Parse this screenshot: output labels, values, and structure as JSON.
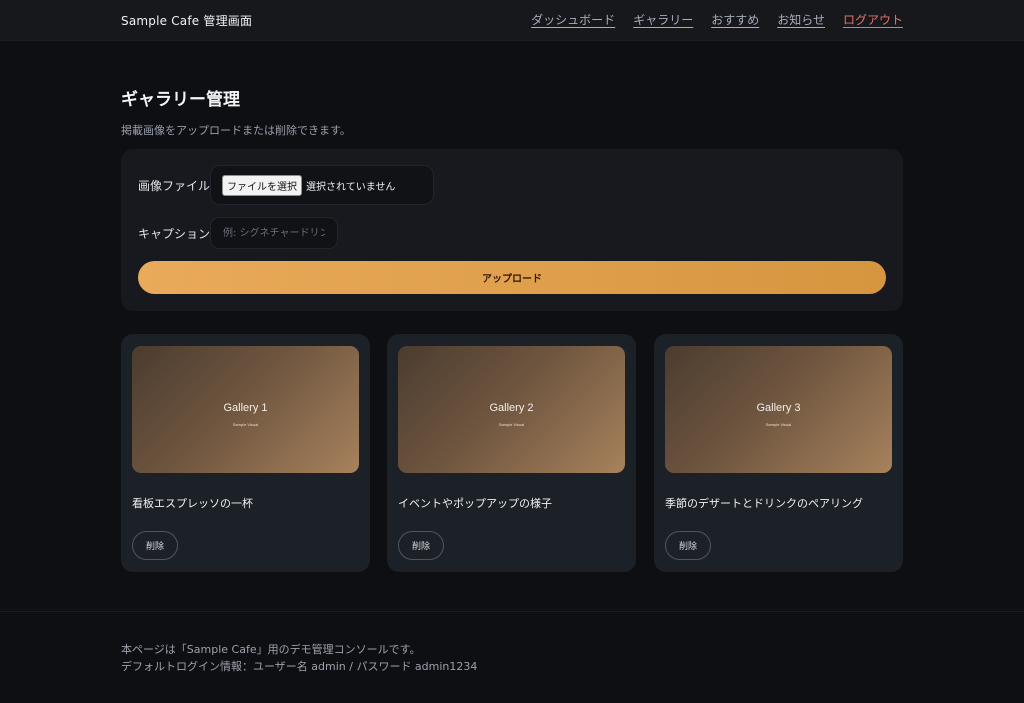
{
  "header": {
    "brand": "Sample Cafe 管理画面",
    "nav": [
      {
        "label": "ダッシュボード"
      },
      {
        "label": "ギャラリー"
      },
      {
        "label": "おすすめ"
      },
      {
        "label": "お知らせ"
      },
      {
        "label": "ログアウト"
      }
    ]
  },
  "page": {
    "title": "ギャラリー管理",
    "subtitle": "掲載画像をアップロードまたは削除できます。"
  },
  "upload": {
    "file_label": "画像ファイル",
    "file_button": "ファイルを選択",
    "file_status": "選択されていません",
    "caption_label": "キャプション",
    "caption_placeholder": "例: シグネチャードリンク",
    "caption_value": "",
    "submit_label": "アップロード"
  },
  "gallery": [
    {
      "visual_title": "Gallery 1",
      "visual_sub": "Sample Visual",
      "caption": "看板エスプレッソの一杯",
      "delete_label": "削除"
    },
    {
      "visual_title": "Gallery 2",
      "visual_sub": "Sample Visual",
      "caption": "イベントやポップアップの様子",
      "delete_label": "削除"
    },
    {
      "visual_title": "Gallery 3",
      "visual_sub": "Sample Visual",
      "caption": "季節のデザートとドリンクのペアリング",
      "delete_label": "削除"
    }
  ],
  "footer": {
    "line1": "本ページは「Sample Cafe」用のデモ管理コンソールです。",
    "line2": "デフォルトログイン情報：ユーザー名 admin / パスワード admin1234"
  },
  "colors": {
    "accent_start": "#e9aa5a",
    "accent_end": "#d6953f",
    "logout": "#e7706c",
    "background": "#0e0f12"
  }
}
